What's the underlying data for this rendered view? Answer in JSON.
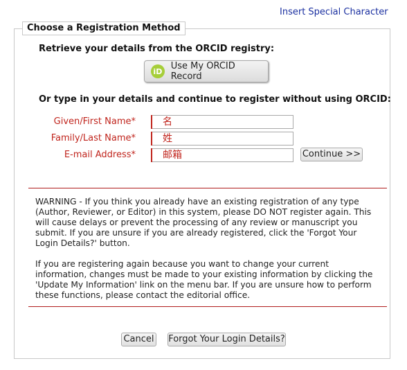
{
  "top_link": "Insert Special Character",
  "legend": "Choose a Registration Method",
  "orcid": {
    "heading": "Retrieve your details from the ORCID registry:",
    "icon_text": "iD",
    "button_label": "Use My ORCID Record"
  },
  "manual_heading": "Or type in your details and continue to register without using ORCID:",
  "fields": {
    "given": {
      "label": "Given/First Name*",
      "value": "名"
    },
    "family": {
      "label": "Family/Last Name*",
      "value": "姓"
    },
    "email": {
      "label": "E-mail Address*",
      "value": "邮箱"
    }
  },
  "continue_label": "Continue >>",
  "warning": {
    "p1": "WARNING - If you think you already have an existing registration of any type (Author, Reviewer, or Editor) in this system, please DO NOT register again. This will cause delays or prevent the processing of any review or manuscript you submit. If you are unsure if you are already registered, click the 'Forgot Your Login Details?' button.",
    "p2": "If you are registering again because you want to change your current information, changes must be made to your existing information by clicking the 'Update My Information' link on the menu bar. If you are unsure how to perform these functions, please contact the editorial office."
  },
  "buttons": {
    "cancel": "Cancel",
    "forgot": "Forgot Your Login Details?"
  },
  "colors": {
    "required_red": "#c0241c",
    "link_blue": "#1a2fa0",
    "orcid_green": "#a6ce39"
  }
}
